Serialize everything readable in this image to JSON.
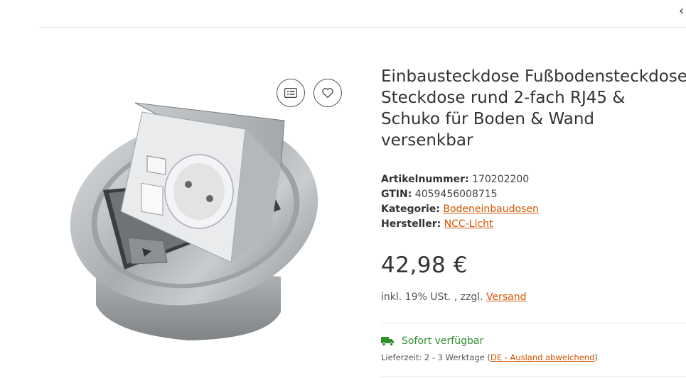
{
  "header": {
    "chevron": "‹"
  },
  "product": {
    "title_lines": [
      "Einbausteckdose Fußbodensteckdose",
      "Steckdose rund 2-fach RJ45 &",
      "Schuko für Boden & Wand",
      "versenkbar"
    ],
    "article_label": "Artikelnummer:",
    "article_value": "170202200",
    "gtin_label": "GTIN:",
    "gtin_value": "4059456008715",
    "category_label": "Kategorie:",
    "category_value": "Bodeneinbaudosen",
    "manufacturer_label": "Hersteller:",
    "manufacturer_value": "NCC-Licht",
    "price": "42,98 €",
    "tax_text": "inkl. 19% USt. , zzgl.",
    "shipping_link": "Versand",
    "stock_text": "Sofort verfügbar",
    "delivery_text": "Lieferzeit: 2 - 3 Werktage",
    "delivery_link_open": "(",
    "delivery_link": "DE - Ausland abweichend",
    "delivery_link_close": ")"
  },
  "colors": {
    "link": "#d35400",
    "stock": "#2f8f2f",
    "text": "#333333"
  },
  "icons": [
    "list-icon",
    "heart-icon",
    "truck-icon",
    "chevron-left-icon"
  ]
}
